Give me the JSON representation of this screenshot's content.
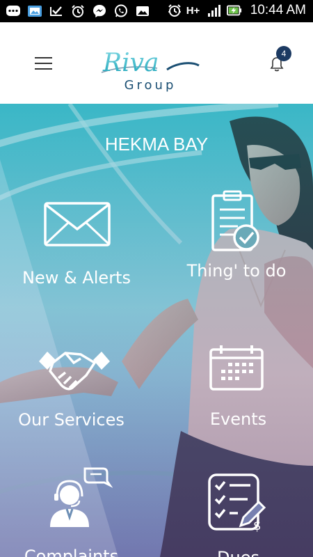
{
  "status_bar": {
    "time": "10:44 AM",
    "network": "H+",
    "icons": [
      "chat-icon",
      "gallery-icon",
      "check-icon",
      "alarm-icon",
      "messenger-icon",
      "whatsapp-icon",
      "image-icon",
      "vibrate-icon",
      "signal-icon",
      "battery-charging-icon"
    ]
  },
  "header": {
    "logo_script": "Riva",
    "logo_sub": "Group",
    "notification_count": "4"
  },
  "hero": {
    "location": "HEKMA BAY"
  },
  "tiles": [
    {
      "label": "New & Alerts",
      "icon": "envelope-icon"
    },
    {
      "label": "Thing' to do",
      "icon": "clipboard-check-icon"
    },
    {
      "label": "Our Services",
      "icon": "handshake-icon"
    },
    {
      "label": "Events",
      "icon": "calendar-icon"
    },
    {
      "label": "Complaints",
      "icon": "support-agent-icon"
    },
    {
      "label": "Dues",
      "icon": "invoice-checklist-icon"
    }
  ],
  "colors": {
    "accent": "#1c3a62",
    "logo_teal": "#2fb3c6",
    "hero_teal": "#3aaebf"
  }
}
